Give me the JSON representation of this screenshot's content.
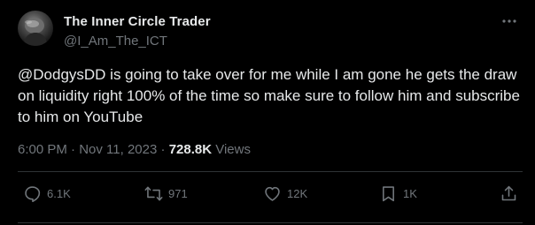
{
  "author": {
    "name": "The Inner Circle Trader",
    "handle": "@I_Am_The_ICT"
  },
  "tweet": {
    "mention": "@DodgysDD",
    "text": " is going to take over for me while I am gone he gets the draw on liquidity right 100% of the time so make sure to follow him and subscribe to him on YouTube"
  },
  "meta": {
    "time": "6:00 PM",
    "separator1": " · ",
    "date": "Nov 11, 2023",
    "separator2": " · ",
    "views_count": "728.8K",
    "views_label": " Views"
  },
  "actions": {
    "replies": "6.1K",
    "retweets": "971",
    "likes": "12K",
    "bookmarks": "1K"
  },
  "icons": {
    "more": "more-dots-icon",
    "reply": "reply-icon",
    "retweet": "retweet-icon",
    "like": "heart-icon",
    "bookmark": "bookmark-icon",
    "share": "share-icon"
  },
  "colors": {
    "background": "#000000",
    "text_primary": "#e7e9ea",
    "text_secondary": "#71767b",
    "divider": "#2f3336"
  }
}
